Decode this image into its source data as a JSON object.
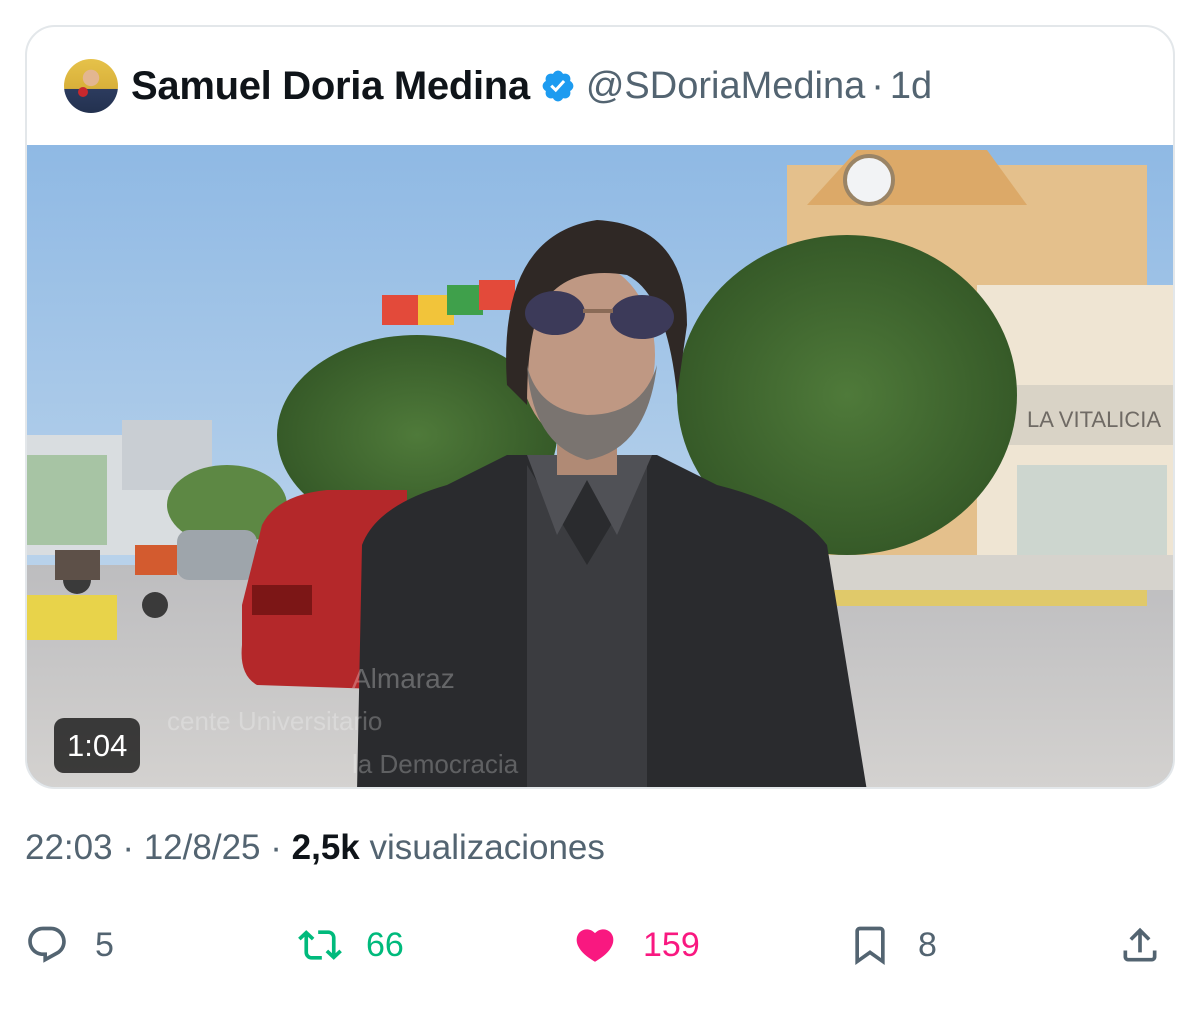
{
  "quoted_post": {
    "author_name": "Samuel Doria Medina",
    "handle": "@SDoriaMedina",
    "separator": "·",
    "age": "1d",
    "video": {
      "duration": "1:04",
      "overlay_lines": [
        "Almaraz",
        "cente Universitario",
        "la Democracia"
      ],
      "sign_text": "LA VITALICIA"
    }
  },
  "post_meta": {
    "time": "22:03",
    "date": "12/8/25",
    "separator": "·",
    "views_count": "2,5k",
    "views_label": "visualizaciones"
  },
  "actions": {
    "replies": "5",
    "reposts": "66",
    "likes": "159",
    "bookmarks": "8"
  },
  "colors": {
    "verified": "#1d9bf0",
    "repost": "#00ba7c",
    "like": "#f91880",
    "muted": "#536471",
    "text": "#0f1419"
  }
}
